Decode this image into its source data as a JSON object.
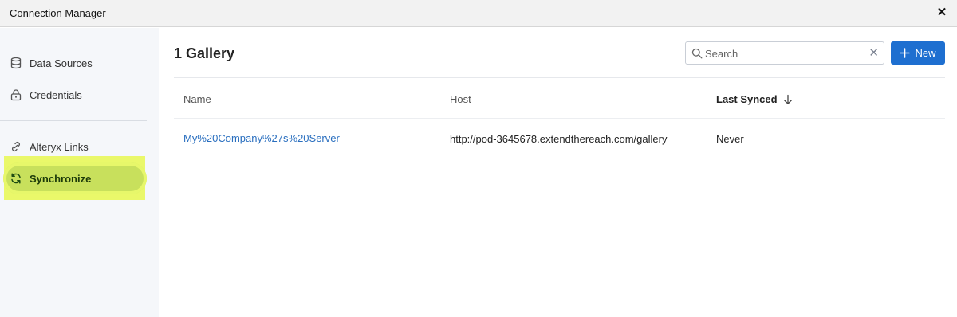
{
  "window": {
    "title": "Connection Manager",
    "close_label": "✕"
  },
  "sidebar": {
    "items": [
      {
        "label": "Data Sources",
        "icon": "database-icon"
      },
      {
        "label": "Credentials",
        "icon": "lock-icon"
      },
      {
        "label": "Alteryx Links",
        "icon": "link-icon"
      },
      {
        "label": "Synchronize",
        "icon": "sync-icon",
        "active": true
      }
    ]
  },
  "main": {
    "title": "1 Gallery",
    "search": {
      "placeholder": "Search",
      "value": ""
    },
    "new_button": {
      "label": "New"
    },
    "table": {
      "columns": [
        "Name",
        "Host",
        "Last Synced"
      ],
      "sorted_column": "Last Synced",
      "sort_direction": "descending",
      "rows": [
        {
          "name": "My%20Company%27s%20Server",
          "host": "http://pod-3645678.extendthereach.com/gallery",
          "last_synced": "Never"
        }
      ]
    }
  },
  "colors": {
    "accent": "#1e6fd0",
    "link": "#2a6fbf",
    "active_highlight": "#c8e05c"
  }
}
